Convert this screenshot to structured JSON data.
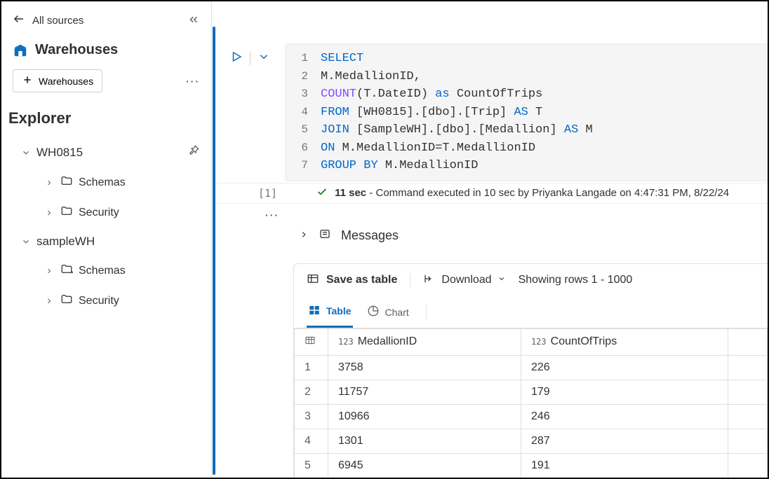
{
  "sidebar": {
    "back_label": "All sources",
    "title": "Warehouses",
    "add_button": "Warehouses",
    "explorer_title": "Explorer",
    "items": [
      {
        "name": "WH0815",
        "children": [
          {
            "label": "Schemas"
          },
          {
            "label": "Security"
          }
        ]
      },
      {
        "name": "sampleWH",
        "children": [
          {
            "label": "Schemas"
          },
          {
            "label": "Security"
          }
        ]
      }
    ]
  },
  "query": {
    "lines": [
      [
        {
          "t": "kw",
          "v": "SELECT"
        }
      ],
      [
        {
          "t": "",
          "v": "M.MedallionID,"
        }
      ],
      [
        {
          "t": "fn",
          "v": "COUNT"
        },
        {
          "t": "",
          "v": "(T.DateID) "
        },
        {
          "t": "kw",
          "v": "as"
        },
        {
          "t": "",
          "v": " CountOfTrips"
        }
      ],
      [
        {
          "t": "kw",
          "v": "FROM"
        },
        {
          "t": "",
          "v": " [WH0815].[dbo].[Trip] "
        },
        {
          "t": "kw",
          "v": "AS"
        },
        {
          "t": "",
          "v": " T"
        }
      ],
      [
        {
          "t": "kw",
          "v": "JOIN"
        },
        {
          "t": "",
          "v": " [SampleWH].[dbo].[Medallion] "
        },
        {
          "t": "kw",
          "v": "AS"
        },
        {
          "t": "",
          "v": " M"
        }
      ],
      [
        {
          "t": "kw",
          "v": "ON"
        },
        {
          "t": "",
          "v": " M.MedallionID=T.MedallionID"
        }
      ],
      [
        {
          "t": "kw",
          "v": "GROUP"
        },
        {
          "t": "",
          "v": " "
        },
        {
          "t": "kw",
          "v": "BY"
        },
        {
          "t": "",
          "v": " M.MedallionID"
        }
      ]
    ]
  },
  "execution": {
    "index": "[1]",
    "duration": "11 sec",
    "message": " - Command executed in 10 sec by Priyanka Langade on 4:47:31 PM, 8/22/24"
  },
  "messages": {
    "label": "Messages"
  },
  "results": {
    "save_label": "Save as table",
    "download_label": "Download",
    "rowcount_label": "Showing rows 1 - 1000",
    "tabs": {
      "table": "Table",
      "chart": "Chart"
    },
    "columns": [
      {
        "name": "MedallionID",
        "type": "123"
      },
      {
        "name": "CountOfTrips",
        "type": "123"
      }
    ],
    "rows": [
      {
        "idx": "1",
        "c0": "3758",
        "c1": "226"
      },
      {
        "idx": "2",
        "c0": "11757",
        "c1": "179"
      },
      {
        "idx": "3",
        "c0": "10966",
        "c1": "246"
      },
      {
        "idx": "4",
        "c0": "1301",
        "c1": "287"
      },
      {
        "idx": "5",
        "c0": "6945",
        "c1": "191"
      }
    ]
  }
}
